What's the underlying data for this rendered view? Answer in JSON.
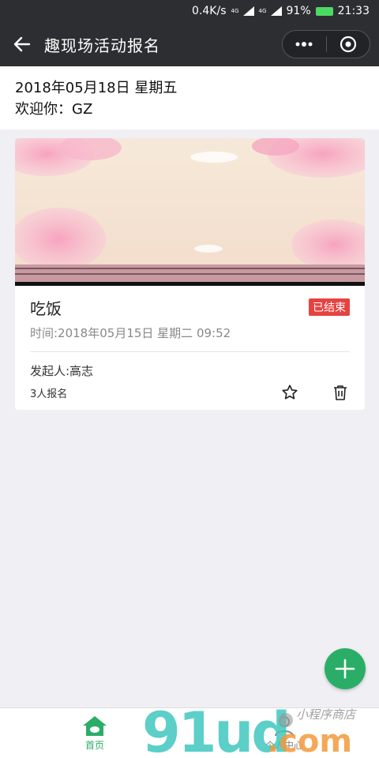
{
  "status_bar": {
    "speed": "0.4K/s",
    "net_type_1": "4G",
    "net_type_2": "4G",
    "battery": "91%",
    "time": "21:33"
  },
  "nav": {
    "title": "趣现场活动报名"
  },
  "header": {
    "date": "2018年05月18日 星期五",
    "welcome": "欢迎你：GZ"
  },
  "activity": {
    "title": "吃饭",
    "status": "已结束",
    "time": "时间:2018年05月15日 星期二 09:52",
    "organizer": "发起人:高志",
    "signup_count": "3人报名"
  },
  "tabs": [
    {
      "label": "首页",
      "icon": "home-icon",
      "active": true
    },
    {
      "label": "个人中心",
      "icon": "person-icon",
      "active": false
    }
  ],
  "watermark": {
    "brand": "91ud",
    "tld": ".com",
    "tagline": "小程序商店"
  },
  "colors": {
    "nav_bg": "#2d2e31",
    "accent": "#2aae67",
    "status_badge": "#e64340",
    "page_bg": "#efeff4"
  }
}
